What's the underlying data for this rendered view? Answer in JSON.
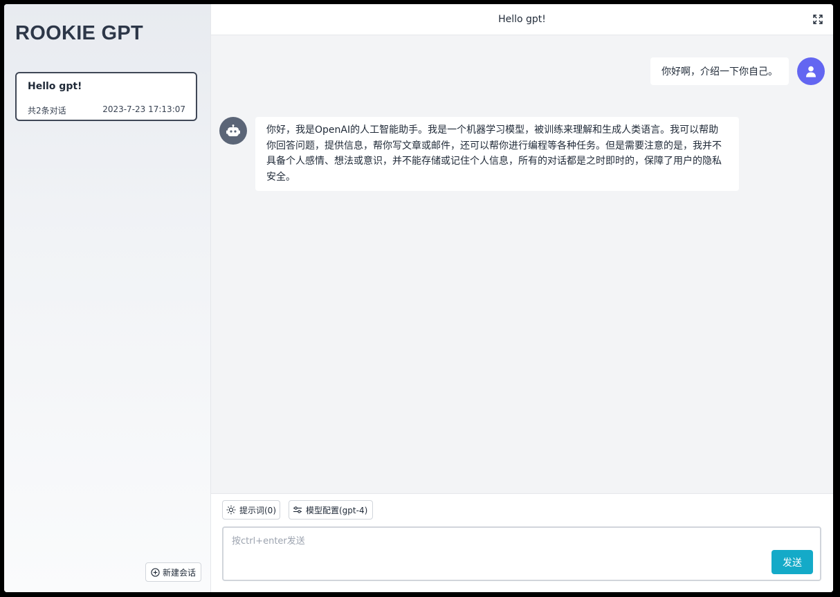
{
  "sidebar": {
    "brand": "ROOKIE GPT",
    "sessions": [
      {
        "title": "Hello gpt!",
        "count": "共2条对话",
        "time": "2023-7-23 17:13:07"
      }
    ],
    "new_chat_label": "新建会话",
    "new_chat_icon": "plus-circle-icon"
  },
  "header": {
    "title": "Hello gpt!",
    "fullscreen_icon": "fullscreen-icon"
  },
  "messages": [
    {
      "role": "user",
      "avatar_icon": "user-icon",
      "text": "你好啊，介绍一下你自己。"
    },
    {
      "role": "assistant",
      "avatar_icon": "robot-icon",
      "text": "你好，我是OpenAI的人工智能助手。我是一个机器学习模型，被训练来理解和生成人类语言。我可以帮助你回答问题，提供信息，帮你写文章或邮件，还可以帮你进行编程等各种任务。但是需要注意的是，我并不具备个人感情、想法或意识，并不能存储或记住个人信息，所有的对话都是之时即时的，保障了用户的隐私安全。"
    }
  ],
  "composer": {
    "prompt_chip_label": "提示词(0)",
    "prompt_chip_icon": "sun-icon",
    "model_chip_label": "模型配置(gpt-4)",
    "model_chip_icon": "sliders-icon",
    "placeholder": "按ctrl+enter发送",
    "value": "",
    "send_label": "发送"
  },
  "colors": {
    "brand_text": "#2d3748",
    "user_avatar": "#6366f1",
    "bot_avatar": "#5b6577",
    "send_button": "#14aac8",
    "chat_background": "#f3f4f6"
  }
}
